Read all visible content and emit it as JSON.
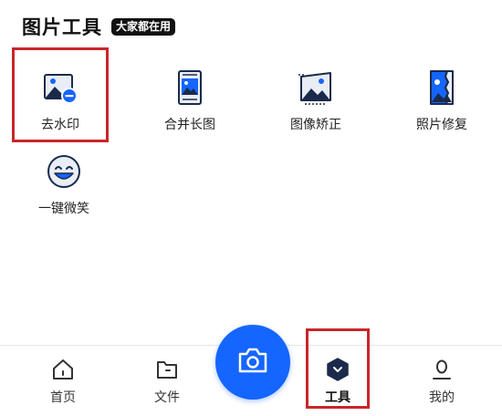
{
  "section": {
    "title": "图片工具",
    "badge": "大家都在用"
  },
  "tools": [
    {
      "label": "去水印",
      "icon": "remove-watermark-icon"
    },
    {
      "label": "合并长图",
      "icon": "merge-long-image-icon"
    },
    {
      "label": "图像矫正",
      "icon": "image-correction-icon"
    },
    {
      "label": "照片修复",
      "icon": "photo-repair-icon"
    },
    {
      "label": "一键微笑",
      "icon": "smile-icon"
    }
  ],
  "nav": {
    "home_label": "首页",
    "files_label": "文件",
    "camera_icon": "camera-icon",
    "tools_label": "工具",
    "mine_label": "我的"
  },
  "colors": {
    "accent": "#1565ff",
    "icon_dark": "#1b2a4a",
    "icon_light": "#e8edf6",
    "highlight": "#c8262b"
  }
}
